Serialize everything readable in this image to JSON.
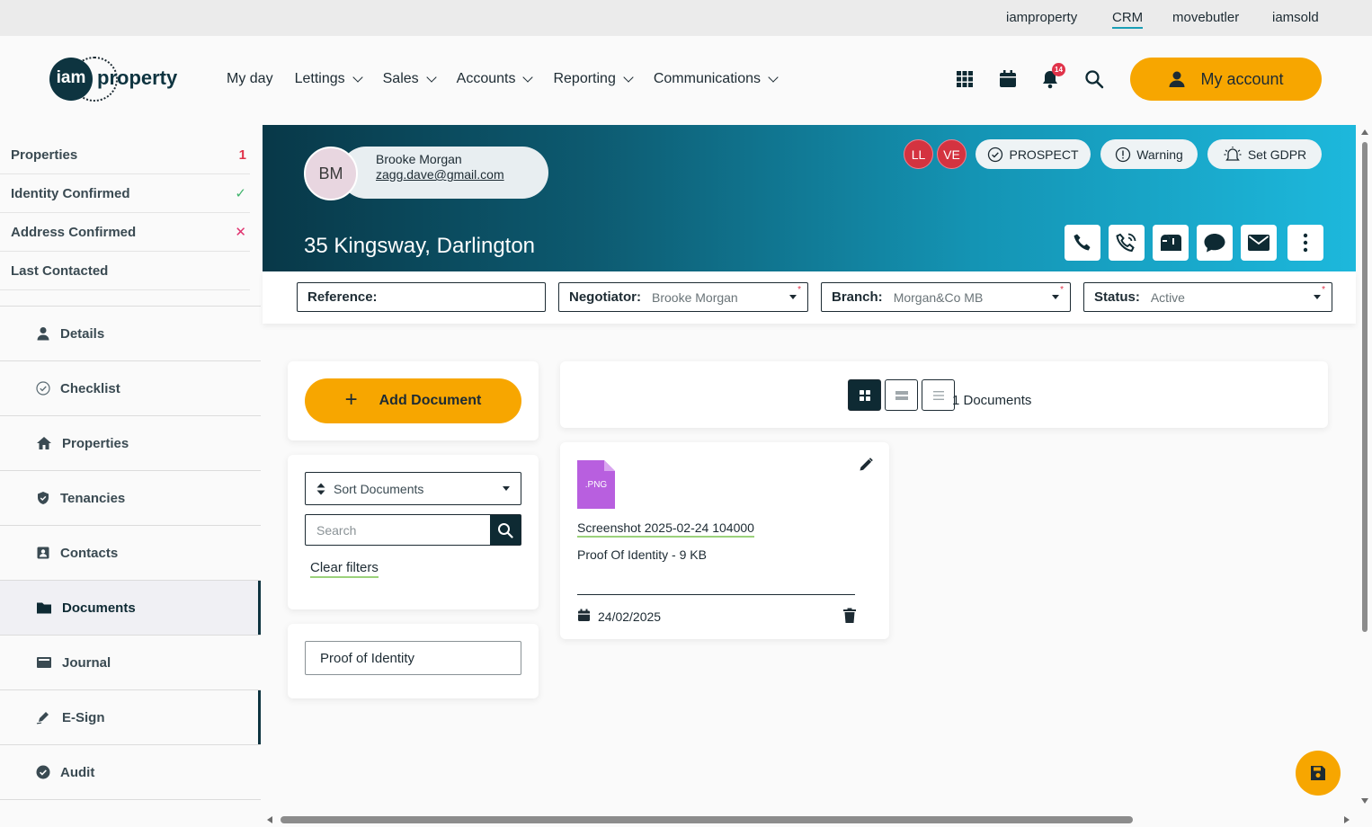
{
  "topbar": {
    "links": [
      {
        "label": "iamproperty"
      },
      {
        "label": "CRM",
        "active": true
      },
      {
        "label": "movebutler"
      },
      {
        "label": "iamsold"
      }
    ]
  },
  "brand": {
    "logo_iam": "iam",
    "logo_property": "property",
    "accent": "#f7a600",
    "dark": "#0e3440"
  },
  "nav": {
    "items": [
      {
        "label": "My day"
      },
      {
        "label": "Lettings"
      },
      {
        "label": "Sales"
      },
      {
        "label": "Accounts"
      },
      {
        "label": "Reporting"
      },
      {
        "label": "Communications"
      }
    ],
    "notifications_count": "14",
    "my_account_label": "My account"
  },
  "sidebar": {
    "stats": [
      {
        "label": "Properties",
        "value": "1",
        "color": "#e0334a"
      },
      {
        "label": "Identity Confirmed",
        "value": "✓",
        "color": "#3fb36b"
      },
      {
        "label": "Address Confirmed",
        "value": "✕",
        "color": "#e0336f"
      },
      {
        "label": "Last Contacted",
        "value": ""
      }
    ],
    "menu": [
      {
        "label": "Details",
        "icon": "person-icon"
      },
      {
        "label": "Checklist",
        "icon": "check-circle-icon"
      },
      {
        "label": "Properties",
        "icon": "home-icon"
      },
      {
        "label": "Tenancies",
        "icon": "shield-icon"
      },
      {
        "label": "Contacts",
        "icon": "contact-card-icon"
      },
      {
        "label": "Documents",
        "icon": "folder-icon",
        "active": true
      },
      {
        "label": "Journal",
        "icon": "journal-icon"
      },
      {
        "label": "E-Sign",
        "icon": "pen-icon"
      },
      {
        "label": "Audit",
        "icon": "check-badge-icon"
      }
    ]
  },
  "contact": {
    "initials": "BM",
    "name": "Brooke Morgan",
    "email": "zagg.dave@gmail.com",
    "address": "35 Kingsway, Darlington",
    "user_badges": [
      "LL",
      "VE"
    ],
    "tags": {
      "prospect": "PROSPECT",
      "warning": "Warning",
      "gdpr": "Set GDPR"
    }
  },
  "fields": {
    "reference": {
      "label": "Reference:",
      "value": ""
    },
    "negotiator": {
      "label": "Negotiator:",
      "value": "Brooke Morgan"
    },
    "branch": {
      "label": "Branch:",
      "value": "Morgan&Co MB"
    },
    "status": {
      "label": "Status:",
      "value": "Active"
    }
  },
  "documents": {
    "add_label": "Add Document",
    "sort_label": "Sort Documents",
    "search_placeholder": "Search",
    "clear_filters": "Clear filters",
    "category_filter": "Proof of Identity",
    "count_label": "1 Documents",
    "files": [
      {
        "ext": ".PNG",
        "name": "Screenshot 2025-02-24 104000",
        "meta": "Proof Of Identity - 9 KB",
        "date": "24/02/2025"
      }
    ]
  }
}
